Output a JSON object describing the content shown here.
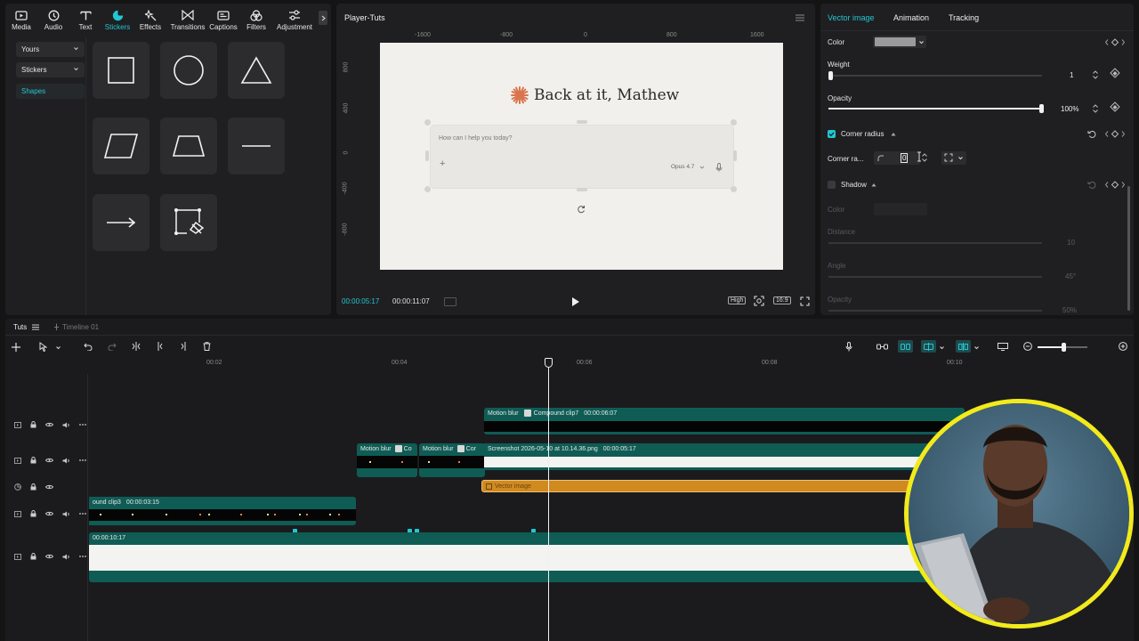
{
  "toolbar": {
    "items": [
      {
        "label": "Media",
        "icon": "media-icon"
      },
      {
        "label": "Audio",
        "icon": "audio-icon"
      },
      {
        "label": "Text",
        "icon": "text-icon"
      },
      {
        "label": "Stickers",
        "icon": "stickers-icon",
        "active": true
      },
      {
        "label": "Effects",
        "icon": "effects-icon"
      },
      {
        "label": "Transitions",
        "icon": "transitions-icon"
      },
      {
        "label": "Captions",
        "icon": "captions-icon"
      },
      {
        "label": "Filters",
        "icon": "filters-icon"
      },
      {
        "label": "Adjustment",
        "icon": "adjustment-icon"
      }
    ]
  },
  "sidebar": {
    "items": [
      {
        "label": "Yours"
      },
      {
        "label": "Stickers"
      },
      {
        "label": "Shapes"
      }
    ]
  },
  "shapes": [
    "square",
    "circle",
    "triangle",
    "parallelogram",
    "trapezoid",
    "line",
    "arrow",
    "custom-pen"
  ],
  "player": {
    "title": "Player-Tuts",
    "ruler_h": [
      "-1600",
      "-800",
      "0",
      "800",
      "1600"
    ],
    "ruler_v": [
      "800",
      "400",
      "0",
      "-400",
      "-800"
    ],
    "canvas": {
      "heading": "Back at it, Mathew",
      "prompt_placeholder": "How can I help you today?",
      "plus": "+",
      "model": "Opus 4.7"
    },
    "current_time": "00:00:05:17",
    "duration": "00:00:11:07",
    "quality": "High",
    "ratio": "16:9"
  },
  "inspector": {
    "tabs": [
      "Vector image",
      "Animation",
      "Tracking"
    ],
    "color_label": "Color",
    "color_value": "#9a9a9a",
    "weight_label": "Weight",
    "weight_value": "1",
    "weight_level": 0.0,
    "opacity_label": "Opacity",
    "opacity_value": "100%",
    "opacity_level": 1.0,
    "corner_label": "Corner radius",
    "corner_sub_label": "Corner ra...",
    "corner_value": "0",
    "shadow_label": "Shadow",
    "shadow_color_label": "Color",
    "distance_label": "Distance",
    "distance_value": "10",
    "angle_label": "Angle",
    "angle_value": "45°",
    "shadow_opacity_label": "Opacity",
    "shadow_opacity_value": "50%"
  },
  "timeline": {
    "tab": "Tuts",
    "sub_tab": "Timeline 01",
    "ruler": [
      "00:02",
      "00:04",
      "00:06",
      "00:08",
      "00:10"
    ],
    "clips": {
      "compound7": {
        "label": "Motion blur",
        "label2": "Compound clip7",
        "duration": "00:00:06:07"
      },
      "mb_a": {
        "label": "Motion blur",
        "label2": "Co"
      },
      "mb_b": {
        "label": "Motion blur",
        "label2": "Cor"
      },
      "screenshot": {
        "label": "Screenshot 2026-05-10 at 10.14.36.png",
        "duration": "00:00:05:17"
      },
      "vector": {
        "label": "Vector image"
      },
      "compound3": {
        "label": "ound clip3",
        "duration": "00:00:03:15"
      },
      "main": {
        "duration": "00:00:10:17"
      }
    }
  },
  "colors": {
    "accent": "#23c6d1",
    "clip_teal": "#0f5c55",
    "vector_clip": "#d08a20",
    "webcam_ring": "#f2ea1b"
  }
}
